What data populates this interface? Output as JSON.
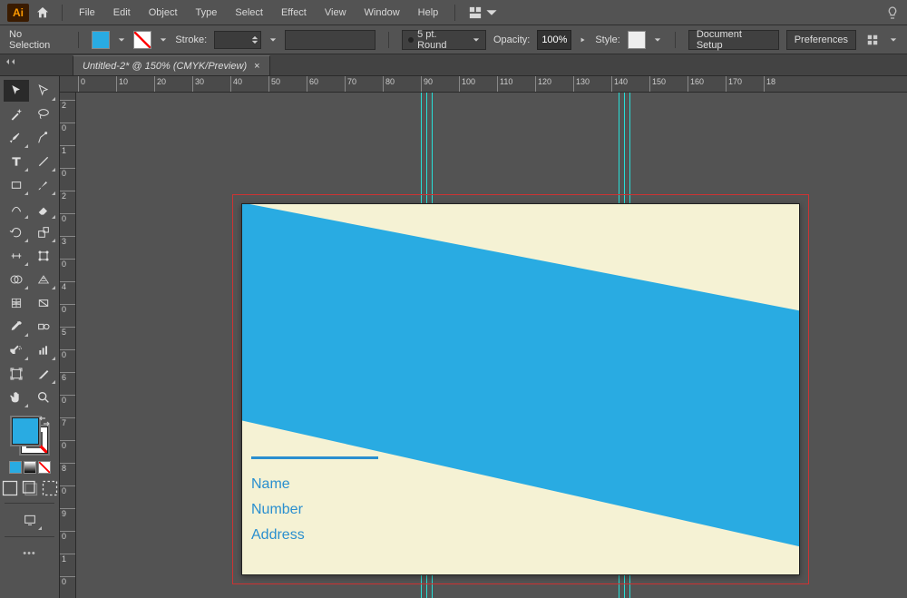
{
  "brand": "Ai",
  "menu": {
    "file": "File",
    "edit": "Edit",
    "object": "Object",
    "type": "Type",
    "select": "Select",
    "effect": "Effect",
    "view": "View",
    "window": "Window",
    "help": "Help"
  },
  "controlbar": {
    "status": "No Selection",
    "stroke_label": "Stroke:",
    "variable_width_profile": "5 pt. Round",
    "opacity_label": "Opacity:",
    "opacity_value": "100%",
    "style_label": "Style:",
    "doc_setup": "Document Setup",
    "preferences": "Preferences"
  },
  "tab": {
    "title": "Untitled-2* @ 150% (CMYK/Preview)"
  },
  "ruler_h": [
    "0",
    "10",
    "20",
    "30",
    "40",
    "50",
    "60",
    "70",
    "80",
    "90",
    "100",
    "110",
    "120",
    "130",
    "140",
    "150",
    "160",
    "170",
    "18"
  ],
  "ruler_v": [
    "2",
    "0",
    "1",
    "0",
    "2",
    "0",
    "3",
    "0",
    "4",
    "0",
    "5",
    "0",
    "6",
    "0",
    "7",
    "0",
    "8",
    "0",
    "9",
    "0",
    "1",
    "0"
  ],
  "artboard": {
    "text1": "Name",
    "text2": "Number",
    "text3": "Address"
  },
  "colors": {
    "accent": "#29abe2",
    "artboard_bg": "#f5f2d4",
    "bleed": "#cc3333",
    "guide": "#27e0d8"
  }
}
